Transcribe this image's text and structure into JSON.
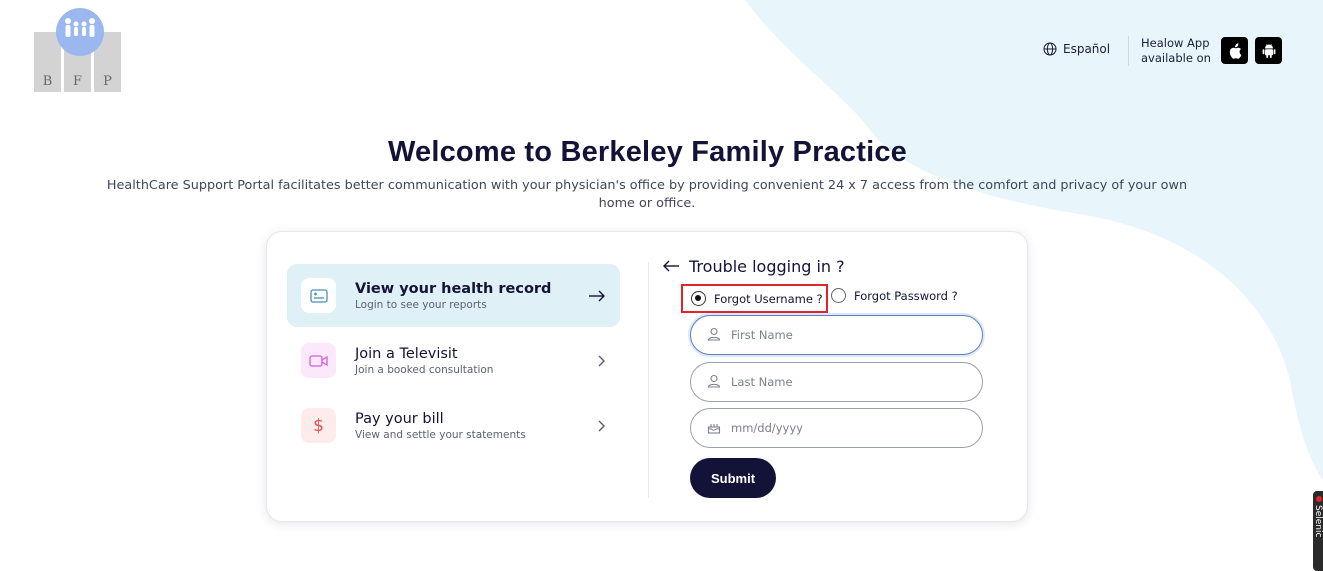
{
  "logo": {
    "letters": [
      "B",
      "F",
      "P"
    ]
  },
  "header": {
    "language_label": "Español",
    "app_label_line1": "Healow App",
    "app_label_line2": "available on",
    "apple_icon": "apple-icon",
    "android_icon": "android-icon"
  },
  "welcome": {
    "title": "Welcome to Berkeley Family Practice",
    "subtitle": "HealthCare Support Portal facilitates better communication with your physician's office by providing convenient 24 x 7 access from the comfort and privacy of your own home or office."
  },
  "menu": [
    {
      "title": "View your health record",
      "subtitle": "Login to see your reports",
      "icon": "health-record-icon",
      "active": true
    },
    {
      "title": "Join a Televisit",
      "subtitle": "Join a booked consultation",
      "icon": "video-icon",
      "active": false
    },
    {
      "title": "Pay your bill",
      "subtitle": "View and settle your statements",
      "icon": "dollar-icon",
      "active": false
    }
  ],
  "trouble": {
    "heading": "Trouble logging in ?",
    "options": [
      {
        "label": "Forgot Username ?",
        "checked": true
      },
      {
        "label": "Forgot Password ?",
        "checked": false
      }
    ],
    "fields": {
      "first_name_placeholder": "First Name",
      "last_name_placeholder": "Last Name",
      "dob_placeholder": "mm/dd/yyyy"
    },
    "submit_label": "Submit"
  },
  "side_widget": {
    "label": "Selenic"
  },
  "colors": {
    "primary": "#131338",
    "active_bg": "#dff0f6",
    "blob": "#e8f5fa",
    "highlight_box": "#e0242c"
  }
}
